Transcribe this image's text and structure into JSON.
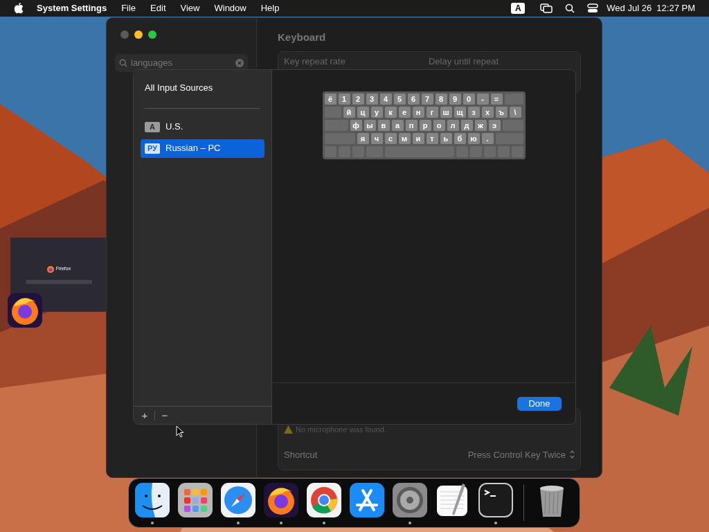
{
  "menu_bar": {
    "app": "System Settings",
    "menus": [
      "File",
      "Edit",
      "View",
      "Window",
      "Help"
    ],
    "input_indicator": "A",
    "clock": "Wed Jul 26  12:27 PM"
  },
  "settings_window": {
    "search": {
      "value": "languages"
    },
    "title": "Keyboard",
    "labels": [
      "Key repeat rate",
      "Delay until repeat"
    ],
    "warning": "No microphone was found.",
    "shortcut": {
      "label": "Shortcut",
      "value": "Press Control Key Twice"
    }
  },
  "thumbnail": {
    "title": "Firefox"
  },
  "sheet": {
    "heading": "All Input Sources",
    "sources": [
      {
        "badge": "A",
        "label": "U.S.",
        "selected": false
      },
      {
        "badge": "РУ",
        "label": "Russian – PC",
        "selected": true
      }
    ],
    "keyboard_rows": [
      [
        "ё",
        "1",
        "2",
        "3",
        "4",
        "5",
        "6",
        "7",
        "8",
        "9",
        "0",
        "-",
        "="
      ],
      [
        "й",
        "ц",
        "у",
        "к",
        "е",
        "н",
        "г",
        "ш",
        "щ",
        "з",
        "х",
        "ъ",
        "\\"
      ],
      [
        "ф",
        "ы",
        "в",
        "а",
        "п",
        "р",
        "о",
        "л",
        "д",
        "ж",
        "э"
      ],
      [
        "я",
        "ч",
        "с",
        "м",
        "и",
        "т",
        "ь",
        "б",
        "ю",
        "."
      ]
    ],
    "add": "+",
    "remove": "−",
    "done": "Done"
  },
  "dock": [
    {
      "kind": "finder",
      "running": true
    },
    {
      "kind": "launchpad",
      "running": false
    },
    {
      "kind": "safari",
      "running": true
    },
    {
      "kind": "firefox",
      "running": true
    },
    {
      "kind": "chrome",
      "running": true
    },
    {
      "kind": "appstore",
      "running": false
    },
    {
      "kind": "settings",
      "running": true
    },
    {
      "kind": "textedit",
      "running": false
    },
    {
      "kind": "terminal",
      "running": true
    },
    {
      "kind": "trash",
      "running": false
    }
  ]
}
